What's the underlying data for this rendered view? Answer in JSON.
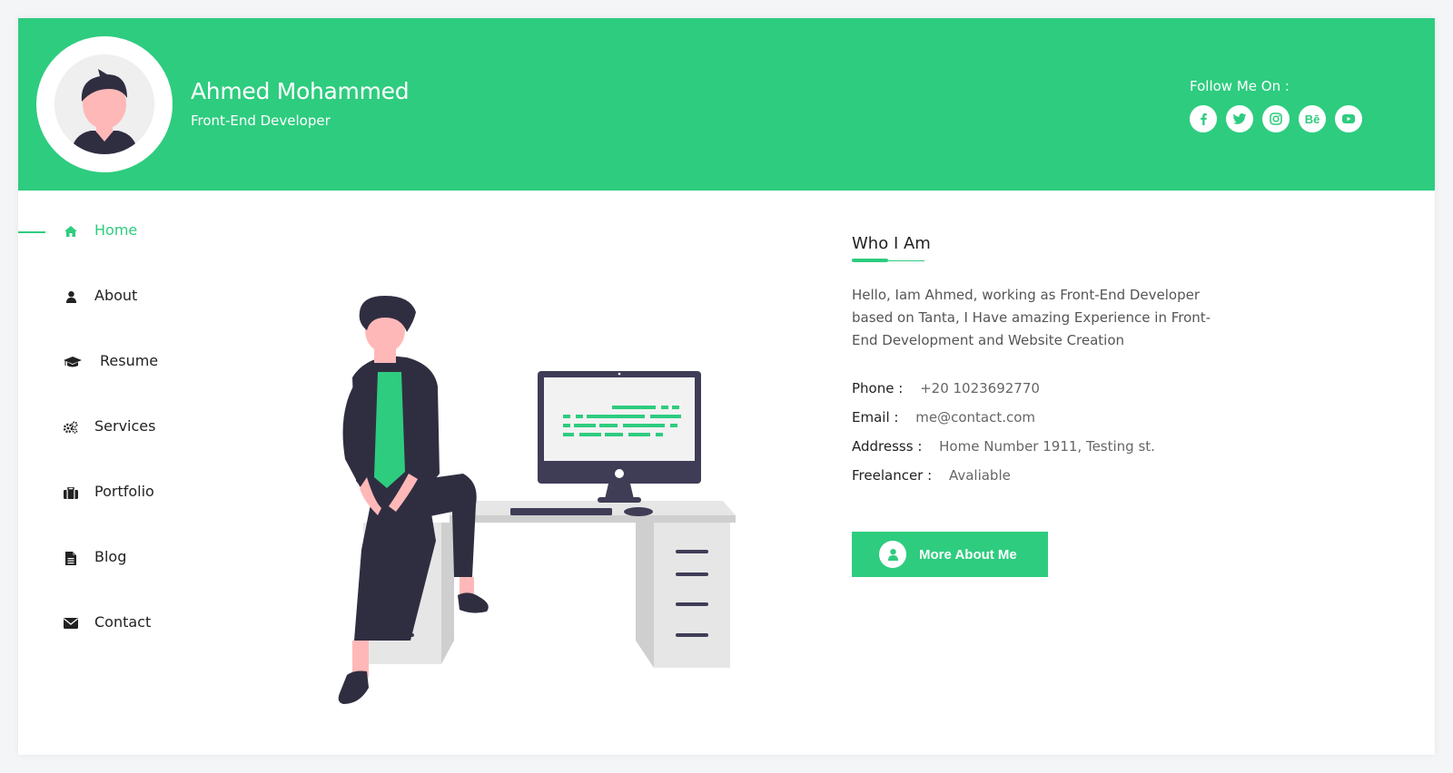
{
  "header": {
    "name": "Ahmed Mohammed",
    "role": "Front-End Developer",
    "follow_label": "Follow Me On :",
    "social": [
      {
        "icon": "facebook-icon",
        "glyph": "f"
      },
      {
        "icon": "twitter-icon",
        "glyph": "t"
      },
      {
        "icon": "instagram-icon",
        "glyph": "ig"
      },
      {
        "icon": "behance-icon",
        "glyph": "Bē"
      },
      {
        "icon": "youtube-icon",
        "glyph": "yt"
      }
    ]
  },
  "nav": {
    "items": [
      {
        "label": "Home",
        "icon": "home-icon",
        "active": true
      },
      {
        "label": "About",
        "icon": "user-icon",
        "active": false
      },
      {
        "label": "Resume",
        "icon": "graduation-cap-icon",
        "active": false
      },
      {
        "label": "Services",
        "icon": "gears-icon",
        "active": false
      },
      {
        "label": "Portfolio",
        "icon": "briefcase-icon",
        "active": false
      },
      {
        "label": "Blog",
        "icon": "document-icon",
        "active": false
      },
      {
        "label": "Contact",
        "icon": "envelope-icon",
        "active": false
      }
    ]
  },
  "about": {
    "title": "Who I Am",
    "text": "Hello, Iam Ahmed, working as Front-End Developer based on Tanta, I Have amazing Experience in Front-End Development and Website Creation",
    "info": [
      {
        "key": "Phone :",
        "value": "+20 1023692770"
      },
      {
        "key": "Email :",
        "value": "me@contact.com"
      },
      {
        "key": "Addresss :",
        "value": "Home Number 1911, Testing st."
      },
      {
        "key": "Freelancer :",
        "value": "Avaliable"
      }
    ],
    "cta_label": "More About Me"
  },
  "colors": {
    "accent": "#2ecc7f",
    "dark": "#2f2e41",
    "skin": "#ffb8b8"
  }
}
